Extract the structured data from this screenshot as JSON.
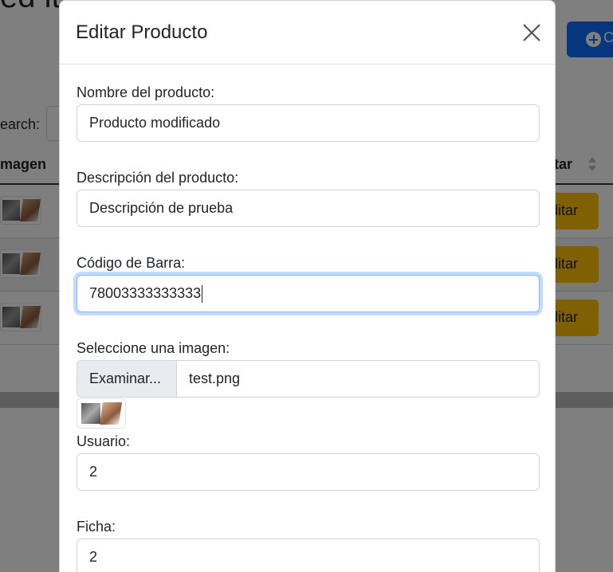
{
  "background": {
    "title_fragment": "ed it",
    "add_button_label": "C",
    "search_label": "earch:",
    "table": {
      "headers": {
        "image": "magen",
        "edit": "itar"
      },
      "rows": [
        {
          "edit_label": "ditar"
        },
        {
          "edit_label": "ditar"
        },
        {
          "edit_label": "ditar"
        }
      ]
    }
  },
  "modal": {
    "title": "Editar Producto",
    "fields": {
      "name": {
        "label": "Nombre del producto:",
        "value": "Producto modificado"
      },
      "description": {
        "label": "Descripción del producto:",
        "value": "Descripción de prueba"
      },
      "barcode": {
        "label": "Código de Barra:",
        "value": "78003333333333"
      },
      "image": {
        "label": "Seleccione una imagen:",
        "button": "Examinar...",
        "file_name": "test.png"
      },
      "user": {
        "label": "Usuario:",
        "value": "2"
      },
      "ficha": {
        "label": "Ficha:",
        "value": "2"
      }
    }
  },
  "colors": {
    "primary": "#0d6efd",
    "warning": "#ffc107",
    "focus_ring": "#86b7fe"
  }
}
